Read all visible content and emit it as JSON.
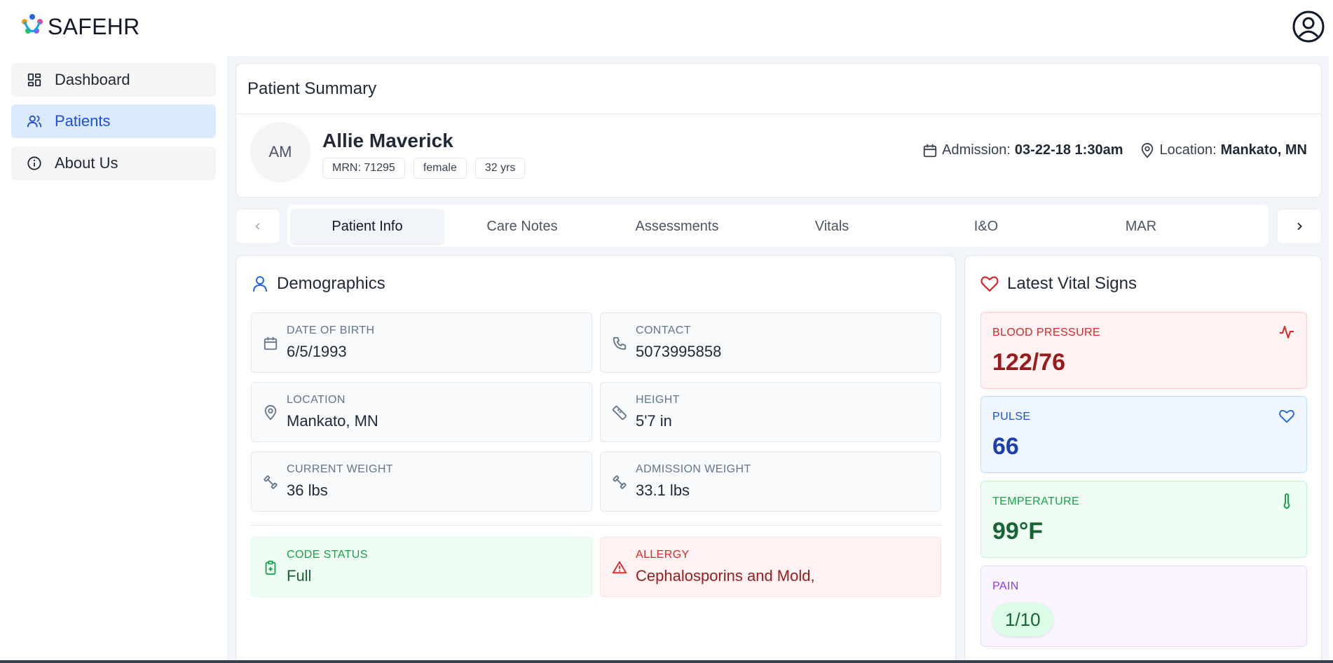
{
  "app": {
    "name": "SAFEHR"
  },
  "sidebar": {
    "items": [
      {
        "label": "Dashboard",
        "icon": "dashboard-icon"
      },
      {
        "label": "Patients",
        "icon": "users-icon",
        "active": true
      },
      {
        "label": "About Us",
        "icon": "info-icon"
      }
    ]
  },
  "summary": {
    "title": "Patient Summary",
    "initials": "AM",
    "name": "Allie Maverick",
    "badges": [
      "MRN: 71295",
      "female",
      "32 yrs"
    ],
    "admission_label": "Admission:",
    "admission_value": "03-22-18 1:30am",
    "location_label": "Location:",
    "location_value": "Mankato, MN"
  },
  "tabs": [
    {
      "label": "Patient Info",
      "active": true
    },
    {
      "label": "Care Notes"
    },
    {
      "label": "Assessments"
    },
    {
      "label": "Vitals"
    },
    {
      "label": "I&O"
    },
    {
      "label": "MAR"
    }
  ],
  "demographics": {
    "title": "Demographics",
    "fields": [
      {
        "label": "DATE OF BIRTH",
        "value": "6/5/1993",
        "icon": "calendar-icon"
      },
      {
        "label": "CONTACT",
        "value": "5073995858",
        "icon": "phone-icon"
      },
      {
        "label": "LOCATION",
        "value": "Mankato, MN",
        "icon": "map-pin-icon"
      },
      {
        "label": "HEIGHT",
        "value": "5'7 in",
        "icon": "ruler-icon"
      },
      {
        "label": "CURRENT WEIGHT",
        "value": "36 lbs",
        "icon": "dumbbell-icon"
      },
      {
        "label": "ADMISSION WEIGHT",
        "value": "33.1 lbs",
        "icon": "dumbbell-icon"
      }
    ],
    "code_status": {
      "label": "CODE STATUS",
      "value": "Full",
      "icon": "clipboard-plus-icon"
    },
    "allergy": {
      "label": "ALLERGY",
      "value": "Cephalosporins and Mold,",
      "icon": "alert-triangle-icon"
    }
  },
  "vitals": {
    "title": "Latest Vital Signs",
    "blood_pressure": {
      "label": "BLOOD PRESSURE",
      "value": "122/76",
      "icon": "activity-icon"
    },
    "pulse": {
      "label": "PULSE",
      "value": "66",
      "icon": "heart-icon"
    },
    "temperature": {
      "label": "TEMPERATURE",
      "value": "99°F",
      "icon": "thermometer-icon"
    },
    "pain": {
      "label": "PAIN",
      "value": "1/10"
    }
  },
  "colors": {
    "accent_blue": "#1d4ed8",
    "active_nav_bg": "#dbeafe",
    "danger": "#dc2626",
    "success": "#16a34a",
    "purple": "#9333ea"
  }
}
